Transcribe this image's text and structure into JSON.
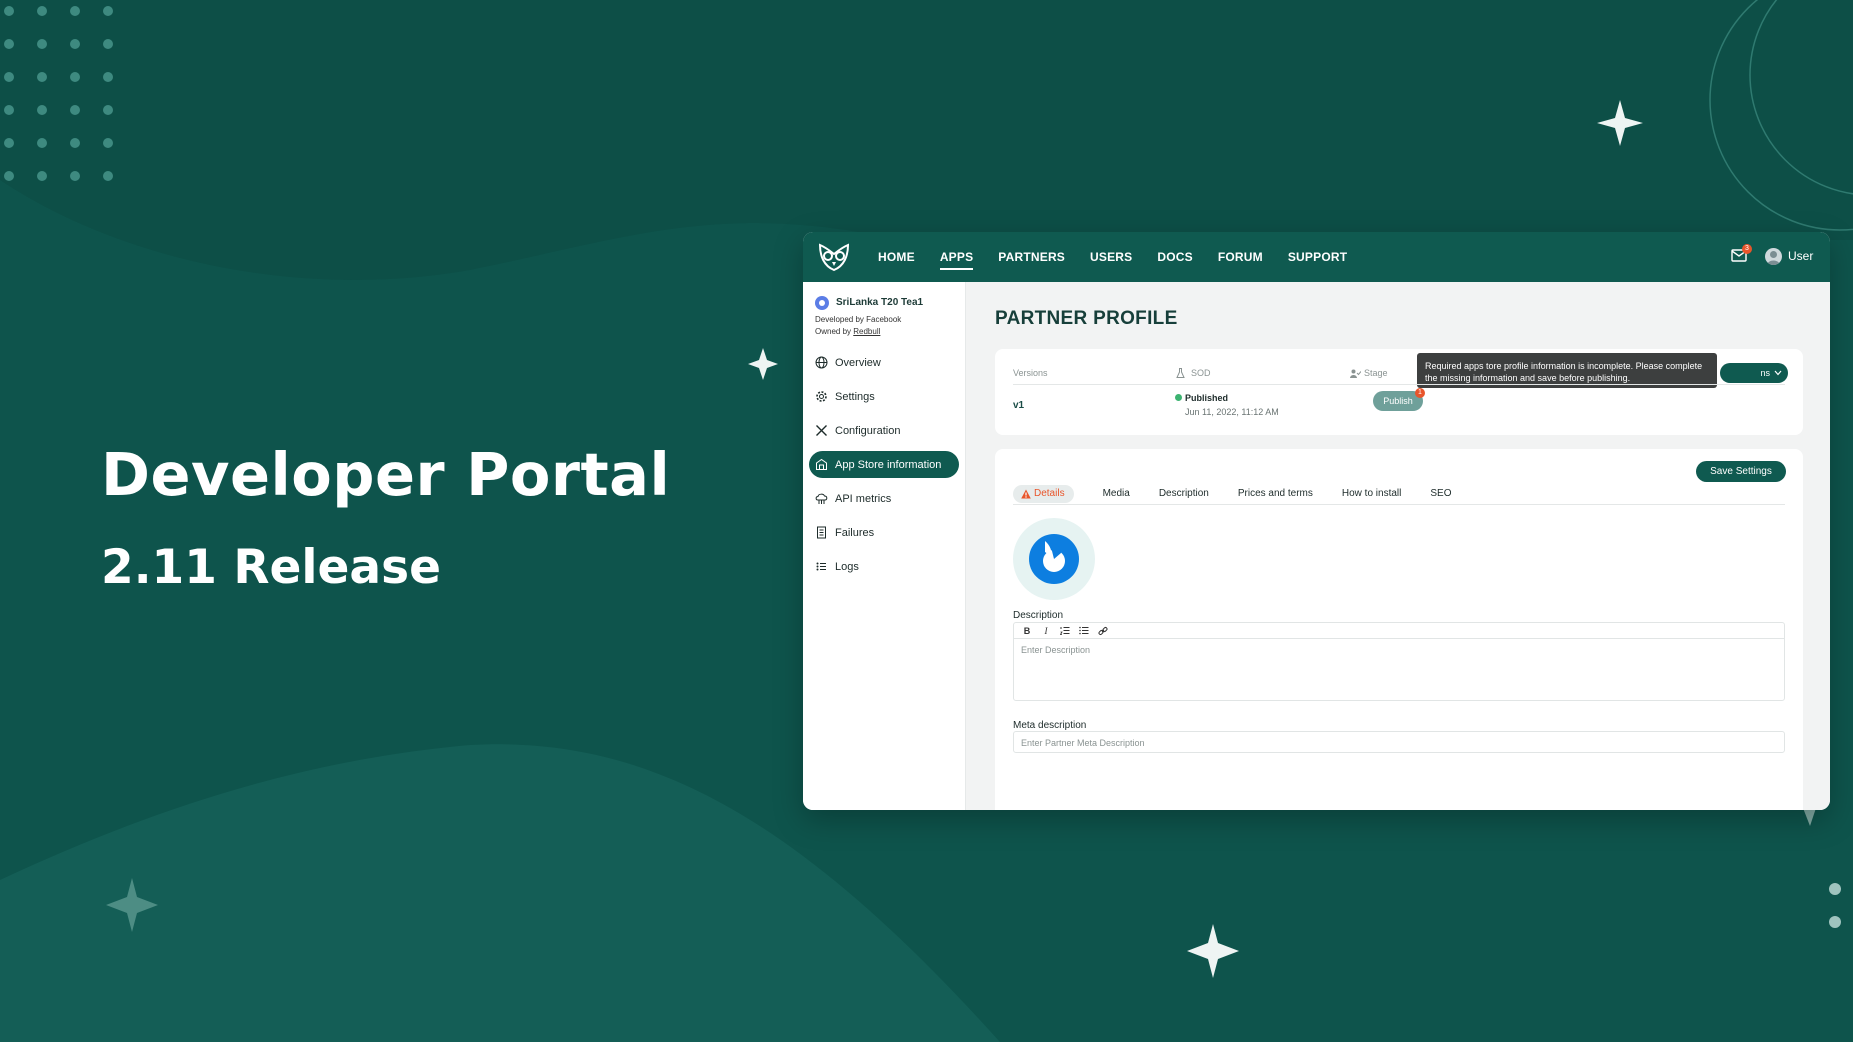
{
  "hero": {
    "title": "Developer Portal",
    "subtitle": "2.11 Release"
  },
  "colors": {
    "background": "#0e544c",
    "brand": "#0f5a50",
    "accent": "#e8552b",
    "published": "#3cb371"
  },
  "nav": {
    "items": [
      "HOME",
      "APPS",
      "PARTNERS",
      "USERS",
      "DOCS",
      "FORUM",
      "SUPPORT"
    ],
    "active": "APPS",
    "mail_badge": "3",
    "user_label": "User"
  },
  "sidebar": {
    "app_name": "SriLanka T20 Tea1",
    "developed_by": "Developed by Facebook",
    "owned_by_prefix": "Owned by ",
    "owned_by_link": "Redbull",
    "items": [
      {
        "label": "Overview",
        "icon": "globe-icon"
      },
      {
        "label": "Settings",
        "icon": "gear-icon"
      },
      {
        "label": "Configuration",
        "icon": "tools-icon"
      },
      {
        "label": "App Store information",
        "icon": "store-icon",
        "active": true
      },
      {
        "label": "API metrics",
        "icon": "cloud-metrics-icon"
      },
      {
        "label": "Failures",
        "icon": "document-icon"
      },
      {
        "label": "Logs",
        "icon": "list-icon"
      }
    ]
  },
  "main": {
    "page_title": "PARTNER PROFILE",
    "versions": {
      "headers": {
        "versions": "Versions",
        "sod": "SOD",
        "stage": "Stage"
      },
      "row": {
        "version": "v1",
        "status": "Published",
        "date": "Jun 11, 2022, 11:12 AM",
        "publish_label": "Publish",
        "publish_badge": "1"
      },
      "actions_label": "ns",
      "tooltip_line1": "Required apps tore profile information is incomplete. Please complete",
      "tooltip_line2": "the missing information and save before publishing."
    },
    "details": {
      "save_label": "Save Settings",
      "tabs": [
        "Details",
        "Media",
        "Description",
        "Prices and terms",
        "How to install",
        "SEO"
      ],
      "active_tab": "Details",
      "description_label": "Description",
      "description_placeholder": "Enter Description",
      "toolbar": [
        "B",
        "I",
        "ordered-list",
        "bullet-list",
        "link"
      ],
      "meta_label": "Meta description",
      "meta_placeholder": "Enter Partner Meta Description"
    }
  }
}
